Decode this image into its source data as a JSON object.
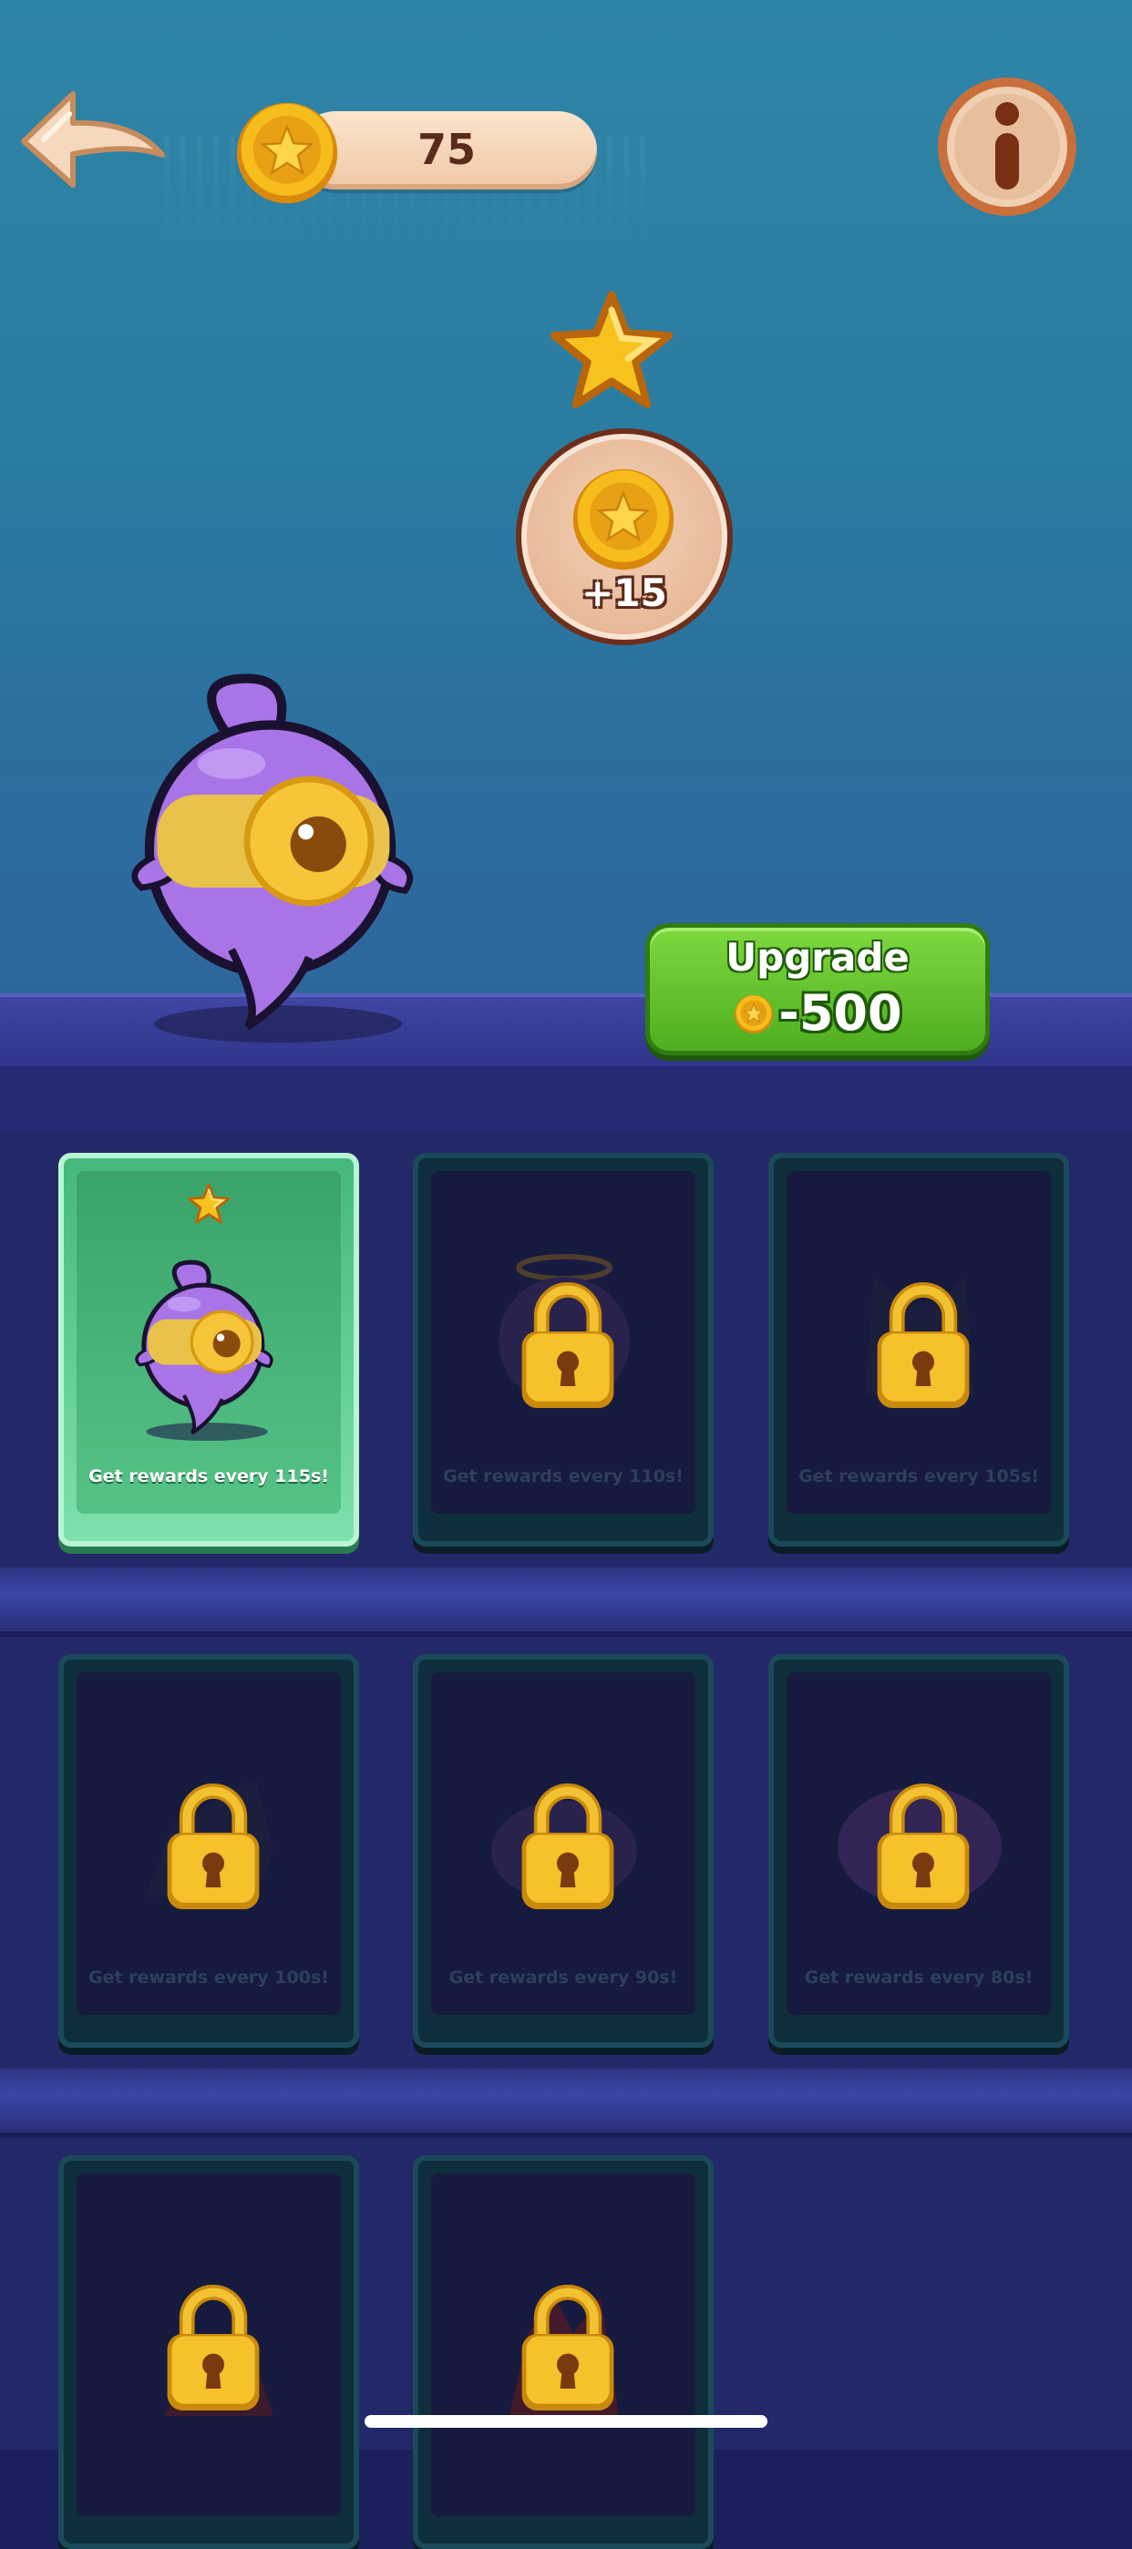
{
  "header": {
    "coins": "75"
  },
  "reward": {
    "amount_label": "+15"
  },
  "upgrade": {
    "title": "Upgrade",
    "cost": "-500"
  },
  "cards": [
    {
      "label": "Get rewards every 115s!",
      "locked": false
    },
    {
      "label": "Get rewards every 110s!",
      "locked": true
    },
    {
      "label": "Get rewards every 105s!",
      "locked": true
    },
    {
      "label": "Get rewards every 100s!",
      "locked": true
    },
    {
      "label": "Get rewards every 90s!",
      "locked": true
    },
    {
      "label": "Get rewards every 80s!",
      "locked": true
    },
    {
      "label": "",
      "locked": true
    },
    {
      "label": "",
      "locked": true
    }
  ],
  "colors": {
    "sky": "#2f85a7",
    "shelf": "#232868",
    "upgrade_green": "#5fc52a",
    "coin_gold": "#f5b81a",
    "pet_purple": "#a874e6"
  }
}
